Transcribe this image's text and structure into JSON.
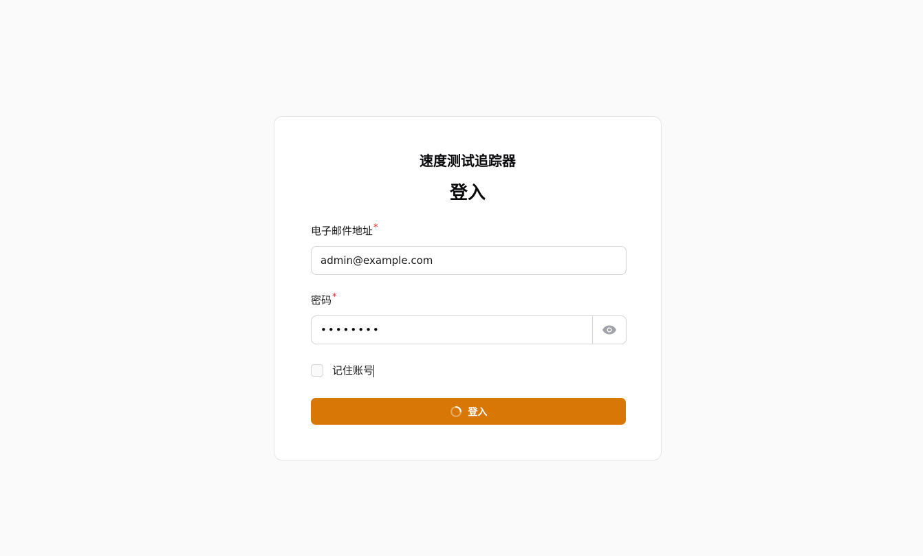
{
  "app": {
    "title": "速度测试追踪器",
    "heading": "登入"
  },
  "form": {
    "email": {
      "label": "电子邮件地址",
      "required_mark": "*",
      "value": "admin@example.com"
    },
    "password": {
      "label": "密码",
      "required_mark": "*",
      "value": "password",
      "toggle_icon": "eye-icon"
    },
    "remember": {
      "label": "记住账号",
      "checked": false
    },
    "submit": {
      "label": "登入",
      "loading": true,
      "icon": "spinner-icon"
    }
  },
  "colors": {
    "accent": "#d97706",
    "background": "#fafafa",
    "required": "#dc2626"
  }
}
